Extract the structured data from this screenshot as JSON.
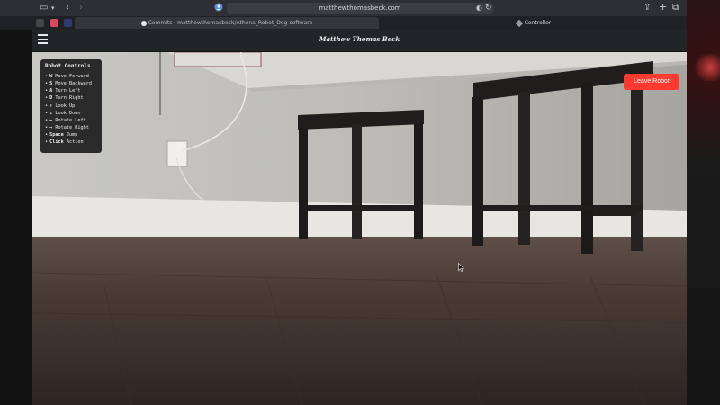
{
  "browser": {
    "url": "matthewthomasbeck.com",
    "tabs": [
      {
        "label": "Commits · matthewthomasbeck/Athena_Robot_Dog-software",
        "active": false
      },
      {
        "label": "Controller",
        "active": true
      }
    ]
  },
  "site": {
    "title": "Matthew Thomas Beck"
  },
  "controls": {
    "title": "Robot Controls",
    "items": [
      {
        "key": "W",
        "action": "Move Forward"
      },
      {
        "key": "S",
        "action": "Move Backward"
      },
      {
        "key": "A",
        "action": "Turn Left"
      },
      {
        "key": "D",
        "action": "Turn Right"
      },
      {
        "key": "↑",
        "action": "Look Up"
      },
      {
        "key": "↓",
        "action": "Look Down"
      },
      {
        "key": "←",
        "action": "Rotate Left"
      },
      {
        "key": "→",
        "action": "Rotate Right"
      },
      {
        "key": "Space",
        "action": "Jump"
      },
      {
        "key": "Click",
        "action": "Action"
      }
    ]
  },
  "leave_button": {
    "label": "Leave Robot",
    "color": "#ff3b30"
  },
  "icons": [
    "sidebar-icon",
    "back-icon",
    "forward-icon",
    "tab-options-icon",
    "privacy-icon",
    "reload-icon",
    "share-icon",
    "new-tab-icon",
    "tab-overview-icon",
    "github-icon",
    "controller-favicon",
    "hamburger-icon",
    "mouse-cursor-icon"
  ]
}
